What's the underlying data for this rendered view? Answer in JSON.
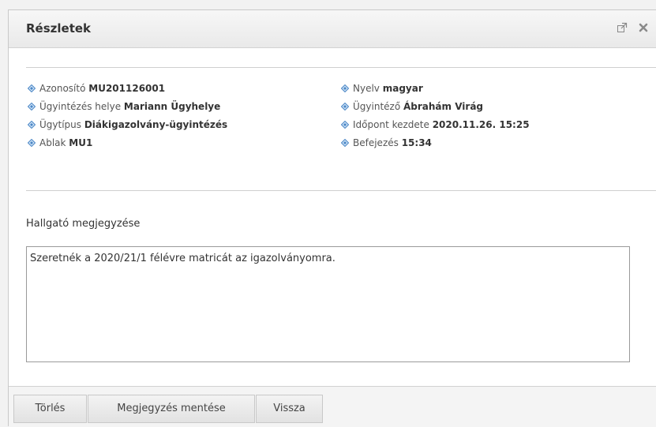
{
  "dialog": {
    "title": "Részletek",
    "popout_icon": "external-link-icon",
    "close_icon": "close-icon"
  },
  "details": {
    "left": [
      {
        "label": "Azonosító",
        "value": "MU201126001"
      },
      {
        "label": "Ügyintézés helye",
        "value": "Mariann Ügyhelye"
      },
      {
        "label": "Ügytípus",
        "value": "Diákigazolvány-ügyintézés"
      },
      {
        "label": "Ablak",
        "value": "MU1"
      }
    ],
    "right": [
      {
        "label": "Nyelv",
        "value": "magyar"
      },
      {
        "label": "Ügyintéző",
        "value": "Ábrahám Virág"
      },
      {
        "label": "Időpont kezdete",
        "value": "2020.11.26. 15:25"
      },
      {
        "label": "Befejezés",
        "value": "15:34"
      }
    ],
    "bullet_color": "#5b9bd5"
  },
  "comment": {
    "label": "Hallgató megjegyzése",
    "text": "Szeretnék a 2020/21/1 félévre matricát az igazolványomra."
  },
  "buttons": {
    "delete": "Törlés",
    "save_comment": "Megjegyzés mentése",
    "back": "Vissza"
  }
}
